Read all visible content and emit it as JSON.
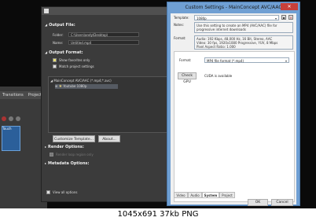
{
  "app": {
    "tabs": [
      "Transitions",
      "Project"
    ],
    "track_label": "Touch"
  },
  "render_dialog": {
    "sections": {
      "output_file": "Output File:",
      "output_format": "Output Format:",
      "render_options": "Render Options:",
      "metadata_options": "Metadata Options:"
    },
    "folder_label": "Folder:",
    "folder_value": "C:\\Users\\andy\\Desktop\\",
    "name_label": "Name:",
    "name_value": "Untitled.mp4",
    "show_favorites_label": "Show favorites only",
    "match_project_label": "Match project settings",
    "tree": {
      "format": "MainConcept AVC/AAC (*.mp4;*.avc)",
      "template": "Youtube 1080p"
    },
    "customize_button": "Customize Template...",
    "about_button": "About...",
    "render_option_faded": "Render loop region only",
    "view_all_options": "View all options"
  },
  "custom_dialog": {
    "title": "Custom Settings - MainConcept AVC/AAC",
    "close_glyph": "✕",
    "template_label": "Template:",
    "template_value": "1080p",
    "notes_label": "Notes:",
    "notes_value": "Use this setting to create an MP4 (AVC/AAC) file for progressive internet downloads",
    "format_label": "Format:",
    "format_lines": [
      "Audio: 192 Kbps, 48,000 Hz, 16 Bit, Stereo, AAC",
      "Video: 30 fps, 1920x1080 Progressive, YUV, 8 Mbps",
      "Pixel Aspect Ratio: 1.000"
    ],
    "panel_format_label": "Format:",
    "panel_format_value": "MP4 file format (*.mp4)",
    "check_gpu_button": "Check GPU",
    "cuda_status": "CUDA is available",
    "tabs": [
      "Video",
      "Audio",
      "System",
      "Project"
    ],
    "active_tab": "System",
    "ok_button": "OK",
    "cancel_button": "Cancel"
  },
  "caption": "1045x691  37kb  PNG",
  "colors": {
    "titlebar_blue": "#6f9fd3",
    "close_red": "#c7403a",
    "dark_bg": "#0a0a0a"
  }
}
